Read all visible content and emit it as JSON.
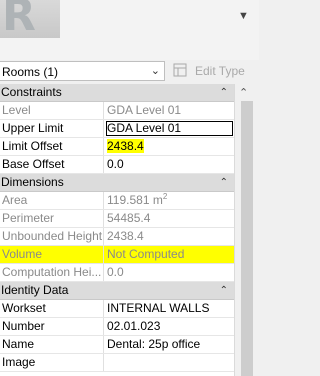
{
  "type_image": {
    "letter": "R"
  },
  "header": {
    "corner_icon": "caret-down-icon"
  },
  "type_selector": {
    "value": "Rooms (1)"
  },
  "edit_type": {
    "label": "Edit Type"
  },
  "properties": {
    "constraints": {
      "title": "Constraints",
      "rows": [
        {
          "name": "Level",
          "value": "GDA Level 01"
        },
        {
          "name": "Upper Limit",
          "value": "GDA Level 01"
        },
        {
          "name": "Limit Offset",
          "value": "2438.4"
        },
        {
          "name": "Base Offset",
          "value": "0.0"
        }
      ]
    },
    "dimensions": {
      "title": "Dimensions",
      "rows": [
        {
          "name": "Area",
          "value": "119.581 m",
          "unit_sup": "2"
        },
        {
          "name": "Perimeter",
          "value": "54485.4"
        },
        {
          "name": "Unbounded Height",
          "value": "2438.4"
        },
        {
          "name": "Volume",
          "value": "Not Computed"
        },
        {
          "name": "Computation Hei...",
          "value": "0.0"
        }
      ]
    },
    "identity_data": {
      "title": "Identity Data",
      "rows": [
        {
          "name": "Workset",
          "value": "INTERNAL WALLS"
        },
        {
          "name": "Number",
          "value": "02.01.023"
        },
        {
          "name": "Name",
          "value": "Dental: 25p office"
        },
        {
          "name": "Image",
          "value": ""
        }
      ]
    }
  },
  "colors": {
    "highlight": "#ffff00",
    "group_header": "#dcdcdc"
  }
}
